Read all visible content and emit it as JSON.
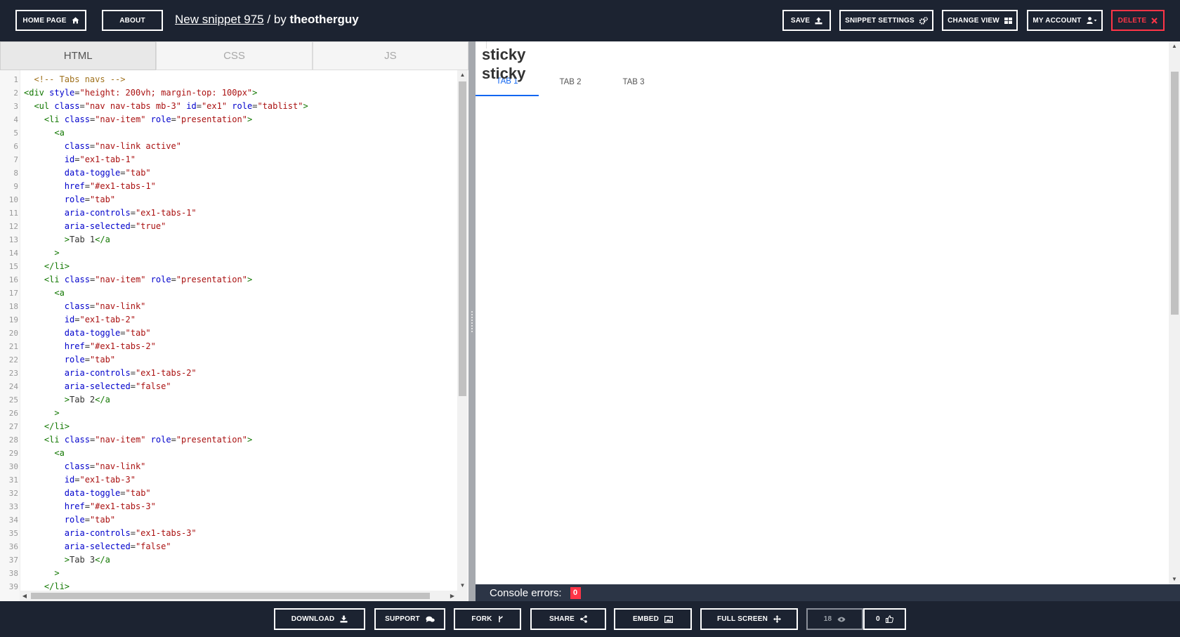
{
  "header": {
    "home_label": "HOME PAGE",
    "about_label": "ABOUT",
    "snippet_title": "New snippet 975",
    "by_text": "/ by",
    "author": "theotherguy",
    "save_label": "SAVE",
    "settings_label": "SNIPPET SETTINGS",
    "change_view_label": "CHANGE VIEW",
    "account_label": "MY ACCOUNT",
    "delete_label": "DELETE"
  },
  "editor": {
    "tabs": [
      {
        "label": "HTML",
        "active": true
      },
      {
        "label": "CSS",
        "active": false
      },
      {
        "label": "JS",
        "active": false
      }
    ],
    "lines": [
      [
        [
          "c-txt",
          "  "
        ],
        [
          "c-com",
          "<!-- Tabs navs -->"
        ]
      ],
      [
        [
          "c-tag",
          "<div"
        ],
        [
          "c-txt",
          " "
        ],
        [
          "c-attr",
          "style"
        ],
        [
          "c-txt",
          "="
        ],
        [
          "c-str",
          "\"height: 200vh; margin-top: 100px\""
        ],
        [
          "c-tag",
          ">"
        ]
      ],
      [
        [
          "c-txt",
          "  "
        ],
        [
          "c-tag",
          "<ul"
        ],
        [
          "c-txt",
          " "
        ],
        [
          "c-attr",
          "class"
        ],
        [
          "c-txt",
          "="
        ],
        [
          "c-str",
          "\"nav nav-tabs mb-3\""
        ],
        [
          "c-txt",
          " "
        ],
        [
          "c-attr",
          "id"
        ],
        [
          "c-txt",
          "="
        ],
        [
          "c-str",
          "\"ex1\""
        ],
        [
          "c-txt",
          " "
        ],
        [
          "c-attr",
          "role"
        ],
        [
          "c-txt",
          "="
        ],
        [
          "c-str",
          "\"tablist\""
        ],
        [
          "c-tag",
          ">"
        ]
      ],
      [
        [
          "c-txt",
          "    "
        ],
        [
          "c-tag",
          "<li"
        ],
        [
          "c-txt",
          " "
        ],
        [
          "c-attr",
          "class"
        ],
        [
          "c-txt",
          "="
        ],
        [
          "c-str",
          "\"nav-item\""
        ],
        [
          "c-txt",
          " "
        ],
        [
          "c-attr",
          "role"
        ],
        [
          "c-txt",
          "="
        ],
        [
          "c-str",
          "\"presentation\""
        ],
        [
          "c-tag",
          ">"
        ]
      ],
      [
        [
          "c-txt",
          "      "
        ],
        [
          "c-tag",
          "<a"
        ]
      ],
      [
        [
          "c-txt",
          "        "
        ],
        [
          "c-attr",
          "class"
        ],
        [
          "c-txt",
          "="
        ],
        [
          "c-str",
          "\"nav-link active\""
        ]
      ],
      [
        [
          "c-txt",
          "        "
        ],
        [
          "c-attr",
          "id"
        ],
        [
          "c-txt",
          "="
        ],
        [
          "c-str",
          "\"ex1-tab-1\""
        ]
      ],
      [
        [
          "c-txt",
          "        "
        ],
        [
          "c-attr",
          "data-toggle"
        ],
        [
          "c-txt",
          "="
        ],
        [
          "c-str",
          "\"tab\""
        ]
      ],
      [
        [
          "c-txt",
          "        "
        ],
        [
          "c-attr",
          "href"
        ],
        [
          "c-txt",
          "="
        ],
        [
          "c-str",
          "\"#ex1-tabs-1\""
        ]
      ],
      [
        [
          "c-txt",
          "        "
        ],
        [
          "c-attr",
          "role"
        ],
        [
          "c-txt",
          "="
        ],
        [
          "c-str",
          "\"tab\""
        ]
      ],
      [
        [
          "c-txt",
          "        "
        ],
        [
          "c-attr",
          "aria-controls"
        ],
        [
          "c-txt",
          "="
        ],
        [
          "c-str",
          "\"ex1-tabs-1\""
        ]
      ],
      [
        [
          "c-txt",
          "        "
        ],
        [
          "c-attr",
          "aria-selected"
        ],
        [
          "c-txt",
          "="
        ],
        [
          "c-str",
          "\"true\""
        ]
      ],
      [
        [
          "c-txt",
          "        "
        ],
        [
          "c-tag",
          ">"
        ],
        [
          "c-txt",
          "Tab 1"
        ],
        [
          "c-tag",
          "</a"
        ]
      ],
      [
        [
          "c-txt",
          "      "
        ],
        [
          "c-tag",
          ">"
        ]
      ],
      [
        [
          "c-txt",
          "    "
        ],
        [
          "c-tag",
          "</li>"
        ]
      ],
      [
        [
          "c-txt",
          "    "
        ],
        [
          "c-tag",
          "<li"
        ],
        [
          "c-txt",
          " "
        ],
        [
          "c-attr",
          "class"
        ],
        [
          "c-txt",
          "="
        ],
        [
          "c-str",
          "\"nav-item\""
        ],
        [
          "c-txt",
          " "
        ],
        [
          "c-attr",
          "role"
        ],
        [
          "c-txt",
          "="
        ],
        [
          "c-str",
          "\"presentation\""
        ],
        [
          "c-tag",
          ">"
        ]
      ],
      [
        [
          "c-txt",
          "      "
        ],
        [
          "c-tag",
          "<a"
        ]
      ],
      [
        [
          "c-txt",
          "        "
        ],
        [
          "c-attr",
          "class"
        ],
        [
          "c-txt",
          "="
        ],
        [
          "c-str",
          "\"nav-link\""
        ]
      ],
      [
        [
          "c-txt",
          "        "
        ],
        [
          "c-attr",
          "id"
        ],
        [
          "c-txt",
          "="
        ],
        [
          "c-str",
          "\"ex1-tab-2\""
        ]
      ],
      [
        [
          "c-txt",
          "        "
        ],
        [
          "c-attr",
          "data-toggle"
        ],
        [
          "c-txt",
          "="
        ],
        [
          "c-str",
          "\"tab\""
        ]
      ],
      [
        [
          "c-txt",
          "        "
        ],
        [
          "c-attr",
          "href"
        ],
        [
          "c-txt",
          "="
        ],
        [
          "c-str",
          "\"#ex1-tabs-2\""
        ]
      ],
      [
        [
          "c-txt",
          "        "
        ],
        [
          "c-attr",
          "role"
        ],
        [
          "c-txt",
          "="
        ],
        [
          "c-str",
          "\"tab\""
        ]
      ],
      [
        [
          "c-txt",
          "        "
        ],
        [
          "c-attr",
          "aria-controls"
        ],
        [
          "c-txt",
          "="
        ],
        [
          "c-str",
          "\"ex1-tabs-2\""
        ]
      ],
      [
        [
          "c-txt",
          "        "
        ],
        [
          "c-attr",
          "aria-selected"
        ],
        [
          "c-txt",
          "="
        ],
        [
          "c-str",
          "\"false\""
        ]
      ],
      [
        [
          "c-txt",
          "        "
        ],
        [
          "c-tag",
          ">"
        ],
        [
          "c-txt",
          "Tab 2"
        ],
        [
          "c-tag",
          "</a"
        ]
      ],
      [
        [
          "c-txt",
          "      "
        ],
        [
          "c-tag",
          ">"
        ]
      ],
      [
        [
          "c-txt",
          "    "
        ],
        [
          "c-tag",
          "</li>"
        ]
      ],
      [
        [
          "c-txt",
          "    "
        ],
        [
          "c-tag",
          "<li"
        ],
        [
          "c-txt",
          " "
        ],
        [
          "c-attr",
          "class"
        ],
        [
          "c-txt",
          "="
        ],
        [
          "c-str",
          "\"nav-item\""
        ],
        [
          "c-txt",
          " "
        ],
        [
          "c-attr",
          "role"
        ],
        [
          "c-txt",
          "="
        ],
        [
          "c-str",
          "\"presentation\""
        ],
        [
          "c-tag",
          ">"
        ]
      ],
      [
        [
          "c-txt",
          "      "
        ],
        [
          "c-tag",
          "<a"
        ]
      ],
      [
        [
          "c-txt",
          "        "
        ],
        [
          "c-attr",
          "class"
        ],
        [
          "c-txt",
          "="
        ],
        [
          "c-str",
          "\"nav-link\""
        ]
      ],
      [
        [
          "c-txt",
          "        "
        ],
        [
          "c-attr",
          "id"
        ],
        [
          "c-txt",
          "="
        ],
        [
          "c-str",
          "\"ex1-tab-3\""
        ]
      ],
      [
        [
          "c-txt",
          "        "
        ],
        [
          "c-attr",
          "data-toggle"
        ],
        [
          "c-txt",
          "="
        ],
        [
          "c-str",
          "\"tab\""
        ]
      ],
      [
        [
          "c-txt",
          "        "
        ],
        [
          "c-attr",
          "href"
        ],
        [
          "c-txt",
          "="
        ],
        [
          "c-str",
          "\"#ex1-tabs-3\""
        ]
      ],
      [
        [
          "c-txt",
          "        "
        ],
        [
          "c-attr",
          "role"
        ],
        [
          "c-txt",
          "="
        ],
        [
          "c-str",
          "\"tab\""
        ]
      ],
      [
        [
          "c-txt",
          "        "
        ],
        [
          "c-attr",
          "aria-controls"
        ],
        [
          "c-txt",
          "="
        ],
        [
          "c-str",
          "\"ex1-tabs-3\""
        ]
      ],
      [
        [
          "c-txt",
          "        "
        ],
        [
          "c-attr",
          "aria-selected"
        ],
        [
          "c-txt",
          "="
        ],
        [
          "c-str",
          "\"false\""
        ]
      ],
      [
        [
          "c-txt",
          "        "
        ],
        [
          "c-tag",
          ">"
        ],
        [
          "c-txt",
          "Tab 3"
        ],
        [
          "c-tag",
          "</a"
        ]
      ],
      [
        [
          "c-txt",
          "      "
        ],
        [
          "c-tag",
          ">"
        ]
      ],
      [
        [
          "c-txt",
          "    "
        ],
        [
          "c-tag",
          "</li>"
        ]
      ]
    ]
  },
  "preview": {
    "sticky_line1": "sticky",
    "sticky_line2": "sticky",
    "tabs": [
      {
        "label": "TAB 1",
        "active": true
      },
      {
        "label": "TAB 2",
        "active": false
      },
      {
        "label": "TAB 3",
        "active": false
      }
    ],
    "accent_color": "#1266f1"
  },
  "console": {
    "label": "Console errors:",
    "count": "0"
  },
  "footer": {
    "download_label": "DOWNLOAD",
    "support_label": "SUPPORT",
    "fork_label": "FORK",
    "share_label": "SHARE",
    "embed_label": "EMBED",
    "fullscreen_label": "FULL SCREEN",
    "views_count": "18",
    "likes_count": "0"
  },
  "colors": {
    "bar_background": "#1c2331",
    "delete": "#ff3547",
    "console_background": "#2c3546"
  }
}
